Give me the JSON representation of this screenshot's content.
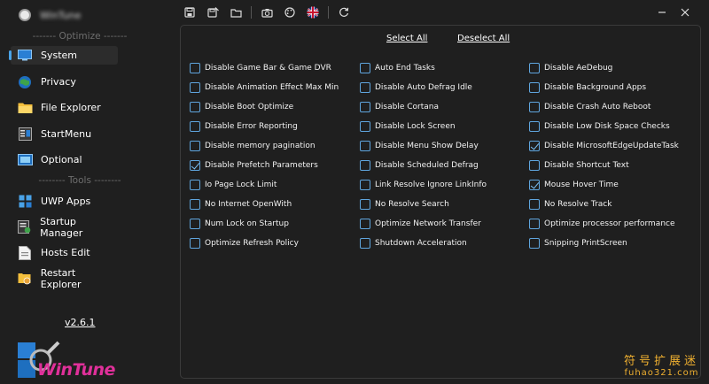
{
  "app": {
    "title": "WinTune",
    "version": "v2.6.1",
    "brand_text": "WinTune"
  },
  "toolbar": {
    "icons": [
      "save-icon",
      "save-as-icon",
      "folder-icon",
      "camera-icon",
      "palette-icon",
      "language-flag-icon",
      "refresh-icon"
    ]
  },
  "sidebar": {
    "optimize_label": "------- Optimize -------",
    "tools_label": "-------- Tools --------",
    "items": [
      {
        "label": "System",
        "icon": "monitor-icon"
      },
      {
        "label": "Privacy",
        "icon": "privacy-icon"
      },
      {
        "label": "File Explorer",
        "icon": "folder-icon"
      },
      {
        "label": "StartMenu",
        "icon": "start-menu-icon"
      },
      {
        "label": "Optional",
        "icon": "optional-icon"
      },
      {
        "label": "UWP Apps",
        "icon": "uwp-apps-icon"
      },
      {
        "label": "Startup Manager",
        "icon": "startup-icon"
      },
      {
        "label": "Hosts Edit",
        "icon": "hosts-icon"
      },
      {
        "label": "Restart Explorer",
        "icon": "restart-icon"
      }
    ]
  },
  "panel": {
    "select_all": "Select All",
    "deselect_all": "Deselect All",
    "columns": [
      [
        {
          "label": "Disable Game Bar & Game DVR",
          "checked": false
        },
        {
          "label": "Disable Animation Effect Max Min",
          "checked": false
        },
        {
          "label": "Disable Boot Optimize",
          "checked": false
        },
        {
          "label": "Disable Error Reporting",
          "checked": false
        },
        {
          "label": "Disable memory pagination",
          "checked": false
        },
        {
          "label": "Disable Prefetch Parameters",
          "checked": true
        },
        {
          "label": "Io Page Lock Limit",
          "checked": false
        },
        {
          "label": "No Internet OpenWith",
          "checked": false
        },
        {
          "label": "Num Lock on Startup",
          "checked": false
        },
        {
          "label": "Optimize Refresh Policy",
          "checked": false
        }
      ],
      [
        {
          "label": "Auto End Tasks",
          "checked": false
        },
        {
          "label": "Disable Auto Defrag Idle",
          "checked": false
        },
        {
          "label": "Disable Cortana",
          "checked": false
        },
        {
          "label": "Disable Lock Screen",
          "checked": false
        },
        {
          "label": "Disable Menu Show Delay",
          "checked": false
        },
        {
          "label": "Disable Scheduled Defrag",
          "checked": false
        },
        {
          "label": "Link Resolve Ignore LinkInfo",
          "checked": false
        },
        {
          "label": "No Resolve Search",
          "checked": false
        },
        {
          "label": "Optimize Network Transfer",
          "checked": false
        },
        {
          "label": "Shutdown Acceleration",
          "checked": false
        }
      ],
      [
        {
          "label": "Disable AeDebug",
          "checked": false
        },
        {
          "label": "Disable Background Apps",
          "checked": false
        },
        {
          "label": "Disable Crash Auto Reboot",
          "checked": false
        },
        {
          "label": "Disable Low Disk Space Checks",
          "checked": false
        },
        {
          "label": "Disable MicrosoftEdgeUpdateTask",
          "checked": true
        },
        {
          "label": "Disable Shortcut Text",
          "checked": false
        },
        {
          "label": "Mouse Hover Time",
          "checked": true
        },
        {
          "label": "No Resolve Track",
          "checked": false
        },
        {
          "label": "Optimize processor performance",
          "checked": false
        },
        {
          "label": "Snipping PrintScreen",
          "checked": false
        }
      ]
    ]
  },
  "watermark": {
    "line1": "符号扩展迷",
    "line2": "fuhao321.com"
  },
  "colors": {
    "background": "#1f1f1f",
    "accent": "#4aa3e8",
    "checkbox_border": "#5fa5de"
  }
}
